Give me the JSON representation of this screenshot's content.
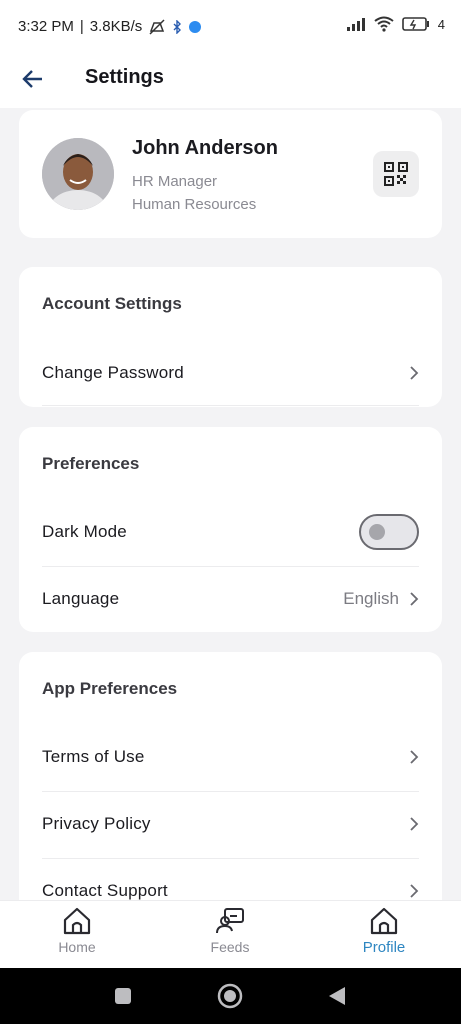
{
  "status_bar": {
    "time": "3:32 PM",
    "network_speed": "3.8KB/s",
    "battery": "4"
  },
  "app_bar": {
    "title": "Settings"
  },
  "profile": {
    "name": "John Anderson",
    "role": "HR Manager",
    "department": "Human Resources"
  },
  "account_settings": {
    "title": "Account Settings",
    "items": [
      {
        "label": "Change Password"
      }
    ]
  },
  "preferences": {
    "title": "Preferences",
    "dark_mode_label": "Dark Mode",
    "dark_mode_on": false,
    "language_label": "Language",
    "language_value": "English"
  },
  "app_preferences": {
    "title": "App Preferences",
    "items": [
      {
        "label": "Terms of Use"
      },
      {
        "label": "Privacy Policy"
      },
      {
        "label": "Contact Support"
      }
    ]
  },
  "bottom_nav": {
    "items": [
      {
        "label": "Home",
        "icon": "home-icon"
      },
      {
        "label": "Feeds",
        "icon": "feeds-icon"
      },
      {
        "label": "Profile",
        "icon": "home-icon",
        "active": true
      }
    ]
  },
  "colors": {
    "accent": "#2e86c1",
    "background": "#f3f3f5",
    "card": "#ffffff"
  }
}
